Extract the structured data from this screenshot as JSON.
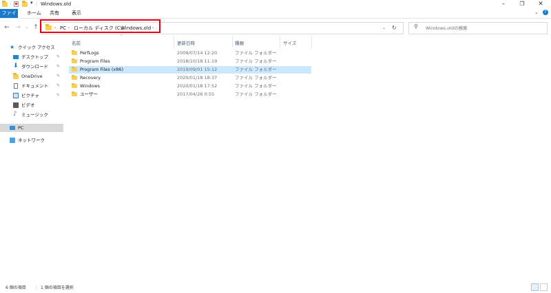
{
  "window": {
    "title": "Windows.old"
  },
  "ribbon": {
    "tabs": [
      "ファイル",
      "ホーム",
      "共有",
      "表示"
    ]
  },
  "address": {
    "crumbs": [
      "PC",
      "ローカル ディスク (C:)",
      "Windows.old"
    ],
    "search_placeholder": "Windows.oldの検索"
  },
  "nav": {
    "items": [
      {
        "label": "クイック アクセス",
        "icon": "star-icon",
        "pinned": false
      },
      {
        "label": "デスクトップ",
        "icon": "desktop-icon",
        "pinned": true
      },
      {
        "label": "ダウンロード",
        "icon": "download-icon",
        "pinned": true
      },
      {
        "label": "OneDrive",
        "icon": "folder-icon",
        "pinned": true
      },
      {
        "label": "ドキュメント",
        "icon": "document-icon",
        "pinned": true
      },
      {
        "label": "ピクチャ",
        "icon": "picture-icon",
        "pinned": true
      },
      {
        "label": "ビデオ",
        "icon": "video-icon",
        "pinned": false
      },
      {
        "label": "ミュージック",
        "icon": "music-icon",
        "pinned": false
      },
      {
        "label": "PC",
        "icon": "pc-icon",
        "pinned": false
      },
      {
        "label": "ネットワーク",
        "icon": "network-icon",
        "pinned": false
      }
    ]
  },
  "columns": [
    "名前",
    "更新日時",
    "種類",
    "サイズ"
  ],
  "files": [
    {
      "name": "PerfLogs",
      "date": "2009/07/14 12:20",
      "type": "ファイル フォルダー",
      "selected": false
    },
    {
      "name": "Program Files",
      "date": "2018/10/18 11:19",
      "type": "ファイル フォルダー",
      "selected": false
    },
    {
      "name": "Program Files (x86)",
      "date": "2019/09/01 15:12",
      "type": "ファイル フォルダー",
      "selected": true
    },
    {
      "name": "Recovery",
      "date": "2020/01/18 18:37",
      "type": "ファイル フォルダー",
      "selected": false
    },
    {
      "name": "Windows",
      "date": "2020/01/18 17:52",
      "type": "ファイル フォルダー",
      "selected": false
    },
    {
      "name": "ユーザー",
      "date": "2017/04/26 0:55",
      "type": "ファイル フォルダー",
      "selected": false
    }
  ],
  "status": {
    "count": "6 個の項目",
    "selected": "1 個の項目を選択"
  },
  "colors": {
    "accent": "#1979ca",
    "selection": "#cce8ff",
    "highlight_border": "#e60012",
    "folder": "#f6cf57"
  }
}
